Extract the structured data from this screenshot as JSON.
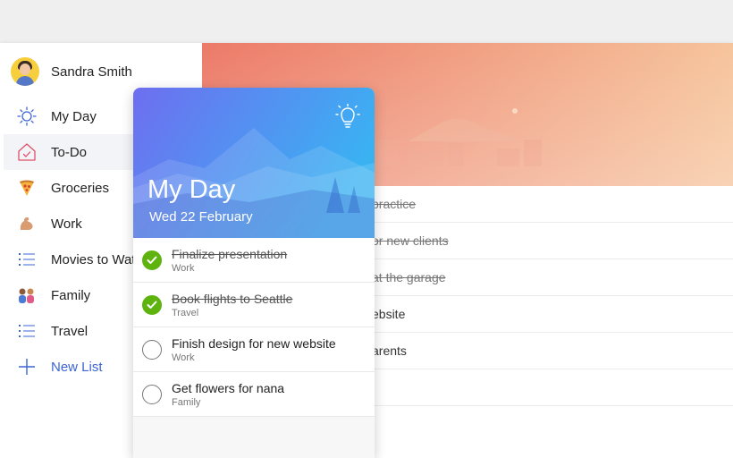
{
  "profile": {
    "name": "Sandra Smith",
    "avatar_icon": "user-avatar"
  },
  "sidebar": {
    "items": [
      {
        "label": "My Day",
        "icon": "sun-icon",
        "active": false
      },
      {
        "label": "To-Do",
        "icon": "house-icon",
        "active": true
      },
      {
        "label": "Groceries",
        "icon": "pizza-emoji",
        "active": false
      },
      {
        "label": "Work",
        "icon": "flexed-arm-emoji",
        "active": false
      },
      {
        "label": "Movies to Watch",
        "icon": "list-icon",
        "active": false
      },
      {
        "label": "Family",
        "icon": "family-emoji",
        "active": false
      },
      {
        "label": "Travel",
        "icon": "list-icon",
        "active": false
      }
    ],
    "new_list": {
      "label": "New List",
      "icon": "plus-icon"
    }
  },
  "background_tasks": [
    {
      "text": "practice",
      "done": true
    },
    {
      "text": "or new clients",
      "done": true
    },
    {
      "text": "at the garage",
      "done": true
    },
    {
      "text": "ebsite",
      "done": false
    },
    {
      "text": "arents",
      "done": false
    }
  ],
  "card": {
    "title": "My Day",
    "date": "Wed 22 February",
    "suggestions_icon": "lightbulb-icon",
    "tasks": [
      {
        "title": "Finalize presentation",
        "list": "Work",
        "done": true
      },
      {
        "title": "Book flights to Seattle",
        "list": "Travel",
        "done": true
      },
      {
        "title": "Finish design for new website",
        "list": "Work",
        "done": false
      },
      {
        "title": "Get flowers for nana",
        "list": "Family",
        "done": false
      }
    ]
  },
  "colors": {
    "accent": "#3b64d6",
    "check_done": "#5fb30f",
    "banner_start": "#ec7a68",
    "banner_end": "#f6c49c",
    "card_gradient_start": "#6e6ef0",
    "card_gradient_end": "#3ab2f2"
  }
}
